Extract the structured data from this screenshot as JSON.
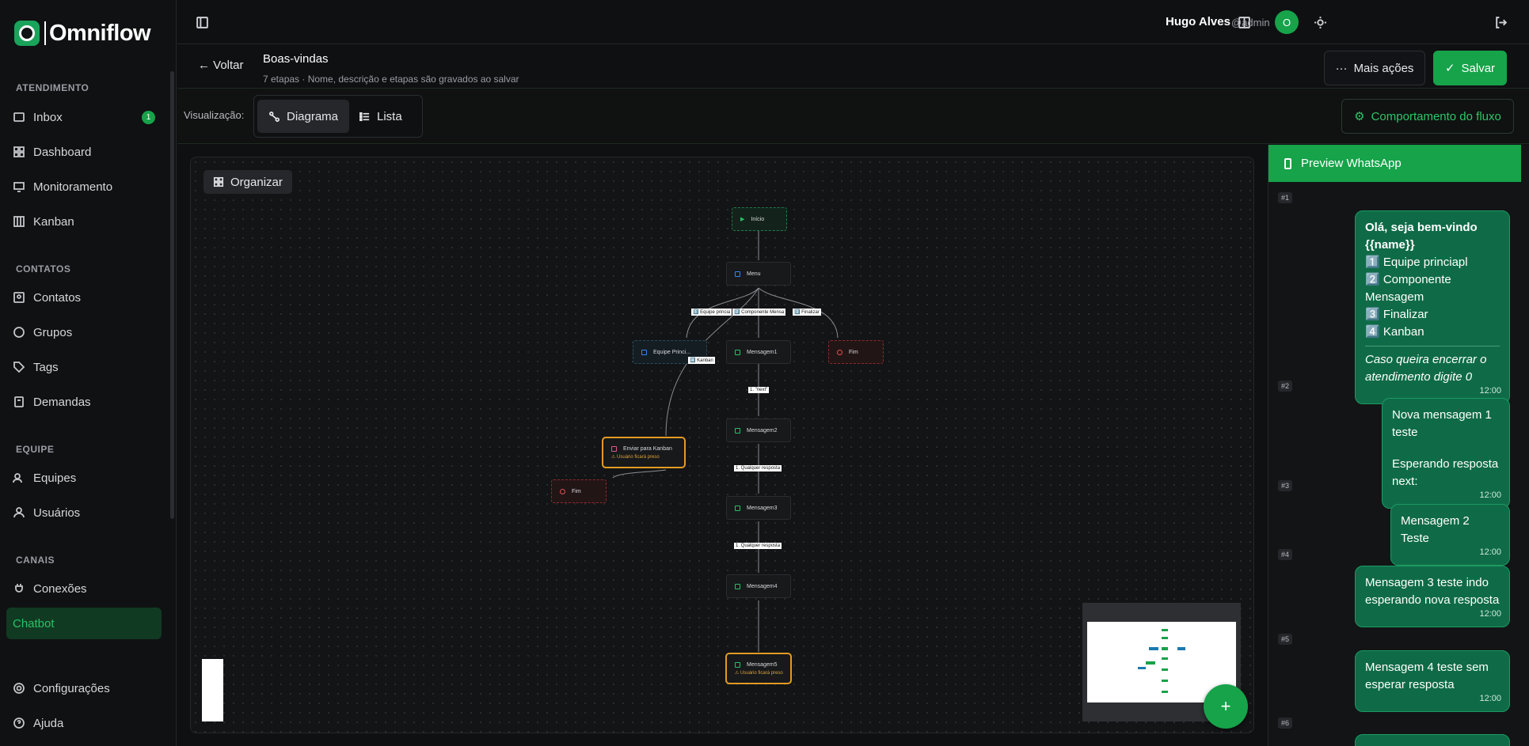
{
  "brand": {
    "name": "Omniflow"
  },
  "sidebar": {
    "sections": [
      "ATENDIMENTO",
      "CONTATOS",
      "EQUIPE",
      "CANAIS"
    ],
    "items": [
      {
        "label": "Inbox",
        "badge": "1"
      },
      {
        "label": "Dashboard"
      },
      {
        "label": "Monitoramento"
      },
      {
        "label": "Kanban"
      },
      {
        "label": "Contatos"
      },
      {
        "label": "Grupos"
      },
      {
        "label": "Tags"
      },
      {
        "label": "Demandas"
      },
      {
        "label": "Equipes"
      },
      {
        "label": "Usuários"
      },
      {
        "label": "Conexões"
      },
      {
        "label": "Chatbot"
      }
    ],
    "footer": [
      {
        "label": "Configurações"
      },
      {
        "label": "Ajuda"
      }
    ]
  },
  "topbar": {
    "user_name": "Hugo Alves",
    "user_handle": "@admin",
    "avatar_initial": "O"
  },
  "header": {
    "back": "← Voltar",
    "title": "Boas-vindas",
    "subtitle": "7 etapas · Nome, descrição e etapas são gravados ao salvar",
    "more": "Mais ações",
    "save": "Salvar"
  },
  "viewbar": {
    "label": "Visualização:",
    "diagram": "Diagrama",
    "list": "Lista",
    "behavior": "Comportamento do fluxo"
  },
  "canvas": {
    "organize": "Organizar",
    "nodes": {
      "start": "Início",
      "menu": "Menu",
      "team": "Equipe Princi...",
      "msg1": "Mensagem1",
      "end1": "Fim",
      "kanban": "Enviar para Kanban",
      "kanban_warn": "⚠ Usuário ficará preso",
      "end2": "Fim",
      "msg2": "Mensagem2",
      "msg3": "Mensagem3",
      "msg4": "Mensagem4",
      "msg5": "Mensagem5",
      "msg5_warn": "⚠ Usuário ficará preso"
    },
    "edges": {
      "e1": "1️⃣ Equipe princia",
      "e2": "2️⃣ Componente Mensa",
      "e3": "3️⃣ Finalizar",
      "e4": "4️⃣ Kanban",
      "e5": "1. \"next\"",
      "e6": "1. Qualquer resposta",
      "e7": "1. Qualquer resposta"
    },
    "fab": "+"
  },
  "preview": {
    "title": "Preview WhatsApp",
    "messages": [
      {
        "num": "#1",
        "title": "Olá, seja bem-vindo {{name}}",
        "lines": [
          "1️⃣ Equipe princiapl",
          "2️⃣ Componente Mensagem",
          "3️⃣ Finalizar",
          "4️⃣ Kanban"
        ],
        "footer": "Caso queira encerrar o atendimento digite 0",
        "time": "12:00"
      },
      {
        "num": "#2",
        "lines": [
          "Nova mensagem 1 teste",
          "",
          "Esperando resposta next:"
        ],
        "time": "12:00"
      },
      {
        "num": "#3",
        "lines": [
          "Mensagem 2 Teste"
        ],
        "time": "12:00"
      },
      {
        "num": "#4",
        "lines": [
          "Mensagem 3 teste indo",
          "esperando nova resposta"
        ],
        "time": "12:00"
      },
      {
        "num": "#5",
        "lines": [
          "Mensagem 4 teste sem",
          "esperar resposta"
        ],
        "time": "12:00"
      },
      {
        "num": "#6"
      }
    ]
  }
}
